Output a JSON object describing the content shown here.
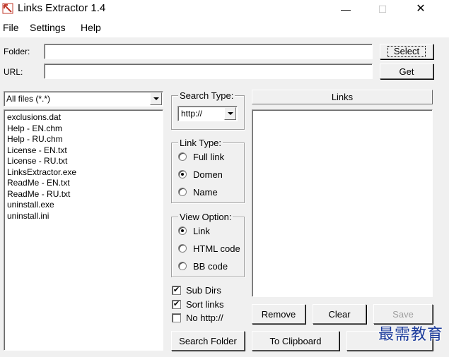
{
  "window": {
    "title": "Links Extractor 1.4",
    "minimize_glyph": "—",
    "maximize_glyph": "☐",
    "close_glyph": "✕"
  },
  "menu": {
    "file": "File",
    "settings": "Settings",
    "help": "Help"
  },
  "folder": {
    "label": "Folder:",
    "value": "",
    "button": "Select"
  },
  "url": {
    "label": "URL:",
    "value": "",
    "button": "Get"
  },
  "filter": {
    "selected": "All files (*.*)"
  },
  "files": [
    "exclusions.dat",
    "Help - EN.chm",
    "Help - RU.chm",
    "License - EN.txt",
    "License - RU.txt",
    "LinksExtractor.exe",
    "ReadMe - EN.txt",
    "ReadMe - RU.txt",
    "uninstall.exe",
    "uninstall.ini"
  ],
  "search_type": {
    "title": "Search Type:",
    "selected": "http://"
  },
  "link_type": {
    "title": "Link Type:",
    "options": [
      "Full link",
      "Domen",
      "Name"
    ],
    "selected": "Domen"
  },
  "view_option": {
    "title": "View Option:",
    "options": [
      "Link",
      "HTML code",
      "BB code"
    ],
    "selected": "Link"
  },
  "checkboxes": {
    "sub_dirs": {
      "label": "Sub Dirs",
      "checked": true
    },
    "sort_links": {
      "label": "Sort links",
      "checked": true
    },
    "no_http": {
      "label": "No http://",
      "checked": false
    }
  },
  "links": {
    "header": "Links",
    "items": []
  },
  "buttons": {
    "search_folder": "Search Folder",
    "remove": "Remove",
    "clear": "Clear",
    "save": "Save",
    "to_clipboard": "To Clipboard"
  },
  "watermark": "最需教育",
  "colors": {
    "client_bg": "#f0f0f0",
    "watermark": "#1a3a9a"
  }
}
